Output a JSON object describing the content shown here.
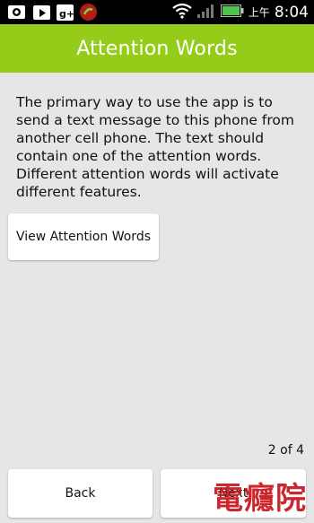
{
  "status_bar": {
    "icons": [
      "photo-icon",
      "play-store-icon",
      "google-plus-icon",
      "phone-app-icon",
      "wifi-icon",
      "signal-icon",
      "battery-icon"
    ],
    "ampm": "上午",
    "time": "8:04"
  },
  "header": {
    "title": "Attention Words",
    "color": "#95cc1a"
  },
  "main": {
    "description": "The primary way to use the app is to send a text message to this phone from another cell phone. The text should contain one of the attention words. Different attention words will activate different features.",
    "view_button_label": "View Attention Words",
    "page_indicator": "2 of 4"
  },
  "footer": {
    "back_label": "Back",
    "next_label": "Next"
  },
  "watermark": {
    "text": "電癮院",
    "color": "#c8151b"
  }
}
